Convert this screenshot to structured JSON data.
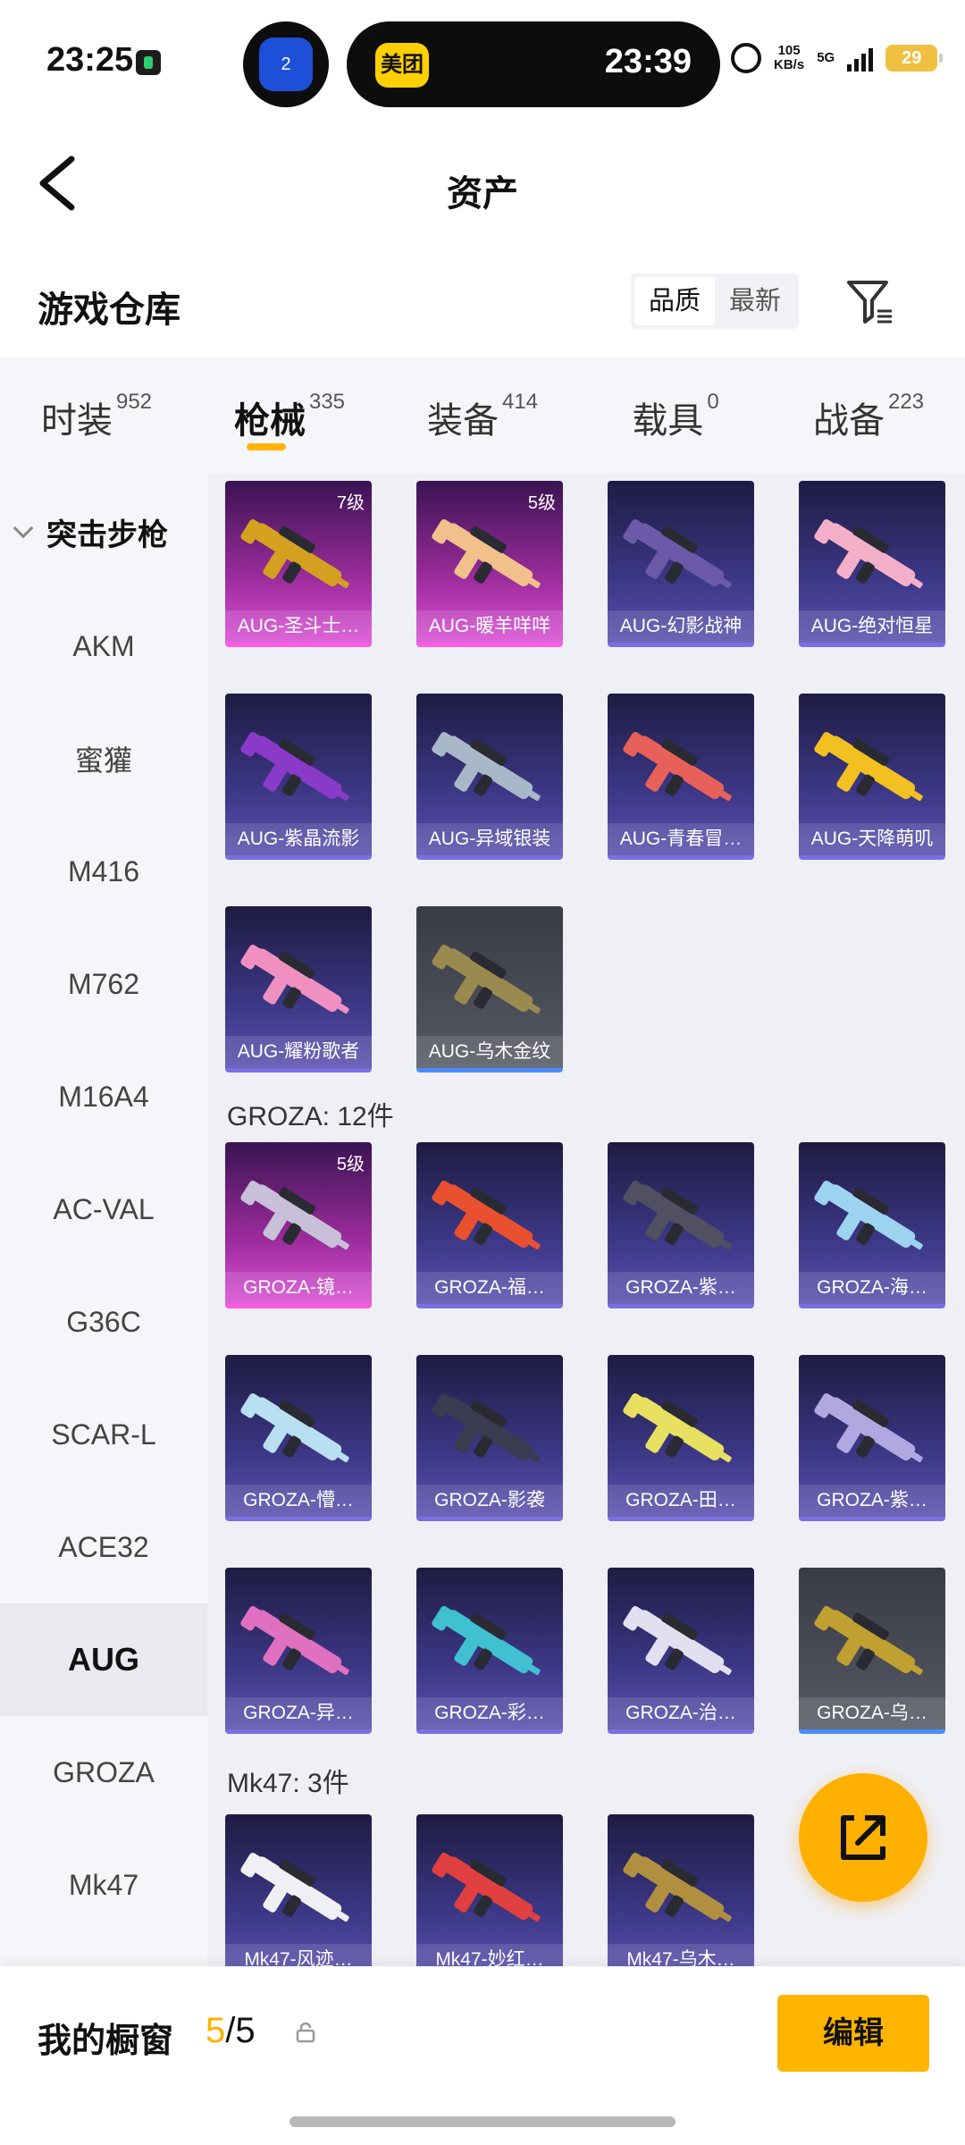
{
  "status": {
    "time": "23:25",
    "island_app": "美团",
    "island_time": "23:39",
    "island_badge_count": "2",
    "net_speed": "105",
    "net_unit": "KB/s",
    "network": "5G",
    "battery": "29"
  },
  "nav": {
    "title": "资产"
  },
  "warehouse": {
    "title": "游戏仓库",
    "sort": [
      "品质",
      "最新"
    ]
  },
  "tabs": [
    {
      "label": "时装",
      "count": "952"
    },
    {
      "label": "枪械",
      "count": "335"
    },
    {
      "label": "装备",
      "count": "414"
    },
    {
      "label": "载具",
      "count": "0"
    },
    {
      "label": "战备",
      "count": "223"
    }
  ],
  "sidebar": {
    "group": "突击步枪",
    "items": [
      "AKM",
      "蜜獾",
      "M416",
      "M762",
      "M16A4",
      "AC-VAL",
      "G36C",
      "SCAR-L",
      "ACE32",
      "AUG",
      "GROZA",
      "Mk47"
    ]
  },
  "sections": [
    {
      "title": "GROZA: 12件"
    },
    {
      "title": "Mk47: 3件"
    }
  ],
  "items": [
    {
      "name": "AUG-圣斗士…",
      "level": "7级",
      "rarity": "pink",
      "color": "#d4a020"
    },
    {
      "name": "AUG-暖羊咩咩",
      "level": "5级",
      "rarity": "pink",
      "color": "#f2c08a"
    },
    {
      "name": "AUG-幻影战神",
      "level": "",
      "rarity": "purple",
      "color": "#6a5aa8"
    },
    {
      "name": "AUG-绝对恒星",
      "level": "",
      "rarity": "purple",
      "color": "#f4b0c8"
    },
    {
      "name": "AUG-紫晶流影",
      "level": "",
      "rarity": "purple",
      "color": "#8a3ac8"
    },
    {
      "name": "AUG-异域银装",
      "level": "",
      "rarity": "purple",
      "color": "#a8b8c8"
    },
    {
      "name": "AUG-青春冒…",
      "level": "",
      "rarity": "purple",
      "color": "#e8605a"
    },
    {
      "name": "AUG-天降萌叽",
      "level": "",
      "rarity": "purple",
      "color": "#f2c020"
    },
    {
      "name": "AUG-耀粉歌者",
      "level": "",
      "rarity": "purple",
      "color": "#f090c0"
    },
    {
      "name": "AUG-乌木金纹",
      "level": "",
      "rarity": "gray",
      "color": "#9a8a50"
    },
    {
      "name": "GROZA-镜…",
      "level": "5级",
      "rarity": "pink",
      "color": "#c8c0d8"
    },
    {
      "name": "GROZA-福…",
      "level": "",
      "rarity": "purple",
      "color": "#e85030"
    },
    {
      "name": "GROZA-紫…",
      "level": "",
      "rarity": "purple",
      "color": "#505060"
    },
    {
      "name": "GROZA-海…",
      "level": "",
      "rarity": "purple",
      "color": "#9cd4f0"
    },
    {
      "name": "GROZA-懵…",
      "level": "",
      "rarity": "purple",
      "color": "#b8e0f0"
    },
    {
      "name": "GROZA-影袭",
      "level": "",
      "rarity": "purple",
      "color": "#3a3a50"
    },
    {
      "name": "GROZA-田…",
      "level": "",
      "rarity": "purple",
      "color": "#e8e060"
    },
    {
      "name": "GROZA-紫…",
      "level": "",
      "rarity": "purple",
      "color": "#b0a8e0"
    },
    {
      "name": "GROZA-异…",
      "level": "",
      "rarity": "purple",
      "color": "#e070c0"
    },
    {
      "name": "GROZA-彩…",
      "level": "",
      "rarity": "purple",
      "color": "#40c0d0"
    },
    {
      "name": "GROZA-治…",
      "level": "",
      "rarity": "purple",
      "color": "#e0e0f0"
    },
    {
      "name": "GROZA-乌…",
      "level": "",
      "rarity": "gray",
      "color": "#c0a030"
    },
    {
      "name": "Mk47-风迹…",
      "level": "",
      "rarity": "purple",
      "color": "#f0f0f4"
    },
    {
      "name": "Mk47-妙红…",
      "level": "",
      "rarity": "purple",
      "color": "#e04040"
    },
    {
      "name": "Mk47-乌木…",
      "level": "",
      "rarity": "purple",
      "color": "#b09040"
    }
  ],
  "bottom": {
    "label": "我的橱窗",
    "count": "5",
    "total": "/5",
    "edit": "编辑"
  },
  "colors": {
    "accent": "#ffb400",
    "pink_rarity": "#ff5be0",
    "purple_rarity": "#7a6ee0",
    "gray_rarity": "#4c8cff"
  }
}
